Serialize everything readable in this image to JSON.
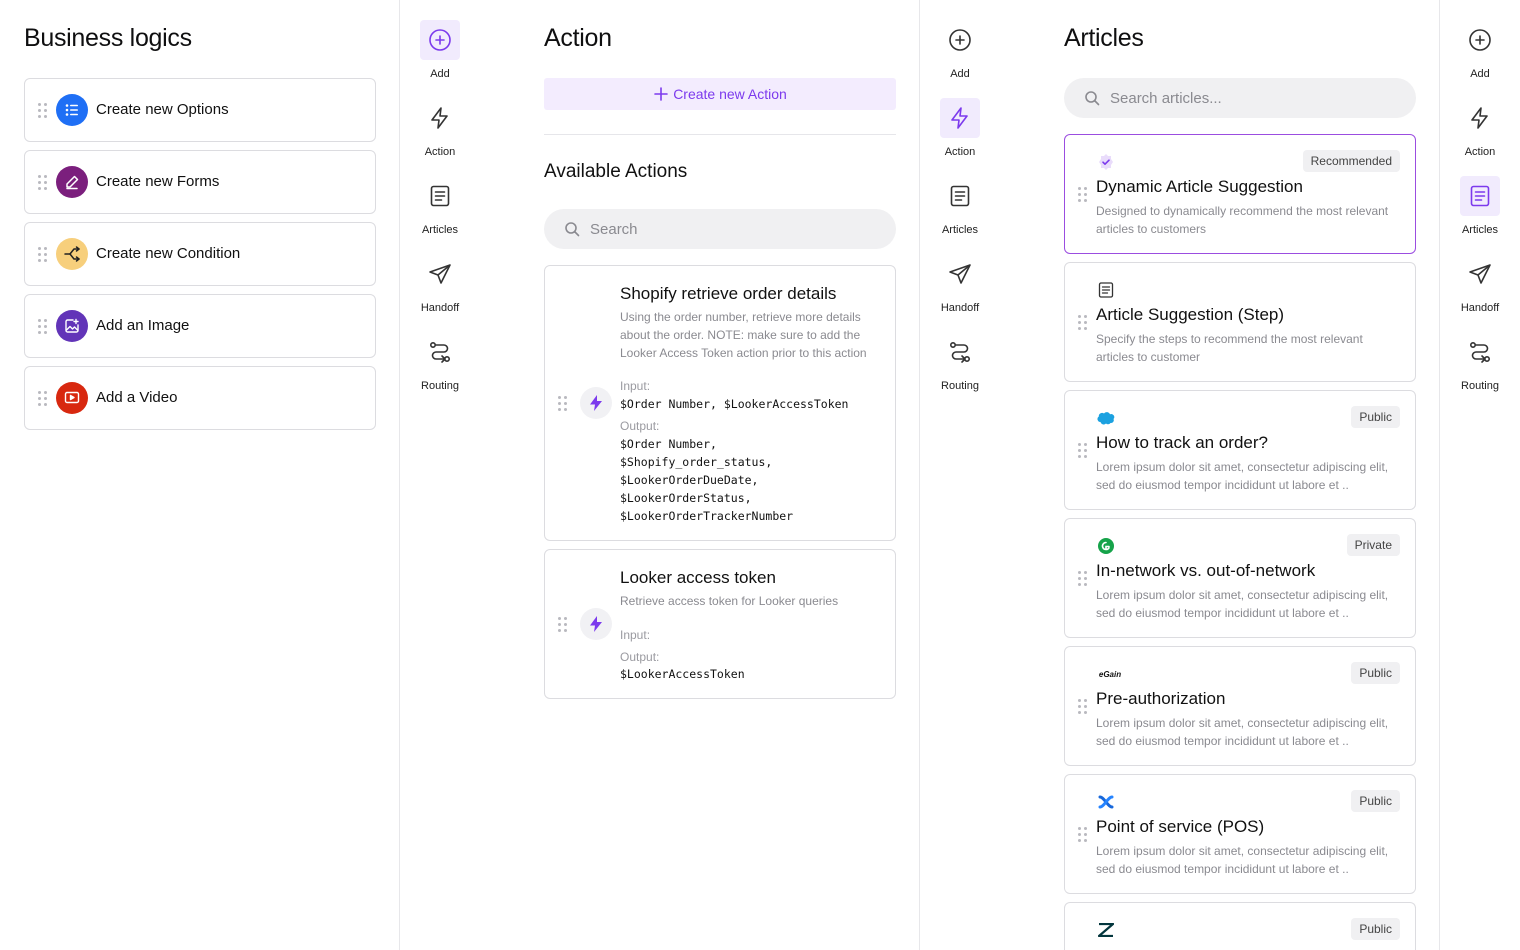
{
  "business_logics": {
    "title": "Business logics",
    "items": [
      {
        "label": "Create new Options",
        "icon": "options-list-icon",
        "color": "#1f6ff5"
      },
      {
        "label": "Create new Forms",
        "icon": "pencil-form-icon",
        "color": "#7b1f7d"
      },
      {
        "label": "Create new Condition",
        "icon": "branch-condition-icon",
        "color": "#f7cf7c"
      },
      {
        "label": "Add an Image",
        "icon": "image-add-icon",
        "color": "#6234b8"
      },
      {
        "label": "Add a Video",
        "icon": "video-play-icon",
        "color": "#d8280f"
      }
    ]
  },
  "nav_rail": {
    "items": [
      {
        "label": "Add",
        "icon": "plus-circle-icon"
      },
      {
        "label": "Action",
        "icon": "lightning-bolt-icon"
      },
      {
        "label": "Articles",
        "icon": "document-icon"
      },
      {
        "label": "Handoff",
        "icon": "paper-plane-icon"
      },
      {
        "label": "Routing",
        "icon": "route-icon"
      }
    ],
    "accent": "#7c3aed"
  },
  "action_panel": {
    "title": "Action",
    "create_button": "Create new Action",
    "section_title": "Available Actions",
    "search_placeholder": "Search",
    "actions": [
      {
        "title": "Shopify retrieve order details",
        "description": "Using the order number, retrieve more details about the order. NOTE: make sure to add the Looker Access Token action prior to this action",
        "input_label": "Input:",
        "input": "$Order Number, $LookerAccessToken",
        "output_label": "Output:",
        "output": "$Order Number,\n$Shopify_order_status,\n$LookerOrderDueDate,\n$LookerOrderStatus,\n$LookerOrderTrackerNumber"
      },
      {
        "title": "Looker access token",
        "description": "Retrieve access token for Looker queries",
        "input_label": "Input:",
        "input": "",
        "output_label": "Output:",
        "output": "$LookerAccessToken"
      }
    ]
  },
  "articles_panel": {
    "title": "Articles",
    "search_placeholder": "Search articles...",
    "articles": [
      {
        "title": "Dynamic Article Suggestion",
        "description": "Designed to dynamically recommend the most relevant articles to customers",
        "badge": "Recommended",
        "logo": "verified-badge-icon"
      },
      {
        "title": "Article Suggestion (Step)",
        "description": "Specify the steps to recommend the most relevant articles to customer",
        "badge": "",
        "logo": "document-icon"
      },
      {
        "title": "How to track an order?",
        "description": "Lorem ipsum dolor sit amet, consectetur adipiscing elit, sed do eiusmod tempor incididunt ut labore et ..",
        "badge": "Public",
        "logo": "salesforce-logo-icon"
      },
      {
        "title": "In-network vs. out-of-network",
        "description": "Lorem ipsum dolor sit amet, consectetur adipiscing elit, sed do eiusmod tempor incididunt ut labore et ..",
        "badge": "Private",
        "logo": "guru-logo-icon"
      },
      {
        "title": "Pre-authorization",
        "description": "Lorem ipsum dolor sit amet, consectetur adipiscing elit, sed do eiusmod tempor incididunt ut labore et ..",
        "badge": "Public",
        "logo": "egain-logo-icon",
        "logo_text": "eGain"
      },
      {
        "title": "Point of service (POS)",
        "description": "Lorem ipsum dolor sit amet, consectetur adipiscing elit, sed do eiusmod tempor incididunt ut labore et ..",
        "badge": "Public",
        "logo": "confluence-logo-icon"
      },
      {
        "title": "",
        "description": "",
        "badge": "Public",
        "logo": "zendesk-logo-icon"
      }
    ]
  }
}
